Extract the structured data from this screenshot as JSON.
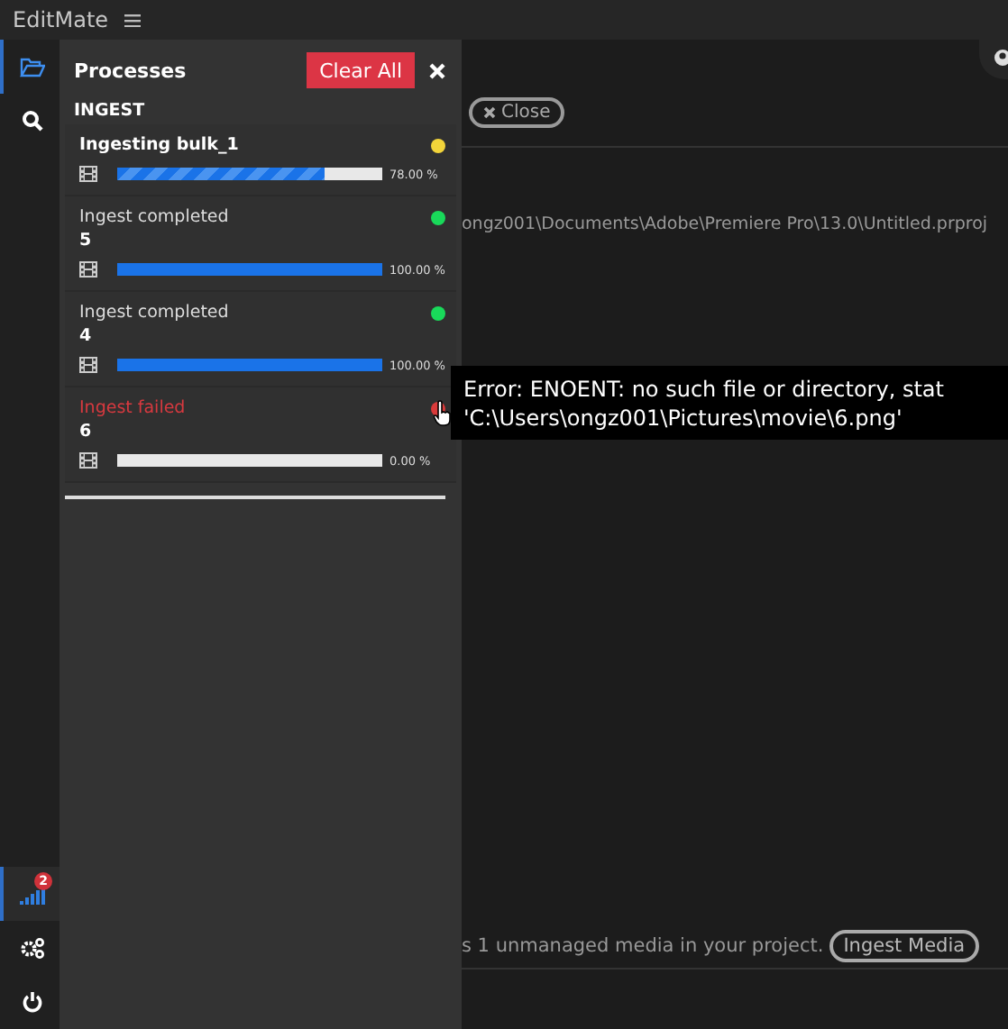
{
  "app": {
    "title": "EditMate"
  },
  "sidebar": {
    "items": [
      {
        "kind": "folder",
        "selected": true
      },
      {
        "kind": "search",
        "selected": false
      },
      {
        "kind": "signal",
        "selected": true,
        "badge": "2"
      },
      {
        "kind": "settings",
        "selected": false
      },
      {
        "kind": "power",
        "selected": false
      }
    ]
  },
  "processes": {
    "title": "Processes",
    "clear_button": "Clear All",
    "section": "INGEST",
    "jobs": [
      {
        "kind": "running",
        "title": "Ingesting bulk_1",
        "color": "#f2d43a",
        "level": 0.78,
        "reading": "78.00 %"
      },
      {
        "kind": "completed",
        "title": "Ingest completed",
        "count": "5",
        "color": "#19d95a",
        "level": 1,
        "reading": "100.00 %"
      },
      {
        "kind": "completed",
        "title": "Ingest completed",
        "count": "4",
        "color": "#19d95a",
        "level": 1,
        "reading": "100.00 %"
      },
      {
        "kind": "failed",
        "title": "Ingest failed",
        "count": "6",
        "color": "#d93a3a",
        "level": 0,
        "reading": "0.00 %"
      }
    ]
  },
  "main": {
    "close_button": "Close",
    "project_path": "ongz001\\Documents\\Adobe\\Premiere Pro\\13.0\\Untitled.prproj",
    "notice": "s 1 unmanaged media in your project.",
    "ingest_button": "Ingest Media"
  },
  "tooltip": {
    "lines": [
      "Error: ENOENT: no such file or directory, stat",
      "'C:\\Users\\ongz001\\Pictures\\movie\\6.png'"
    ]
  }
}
